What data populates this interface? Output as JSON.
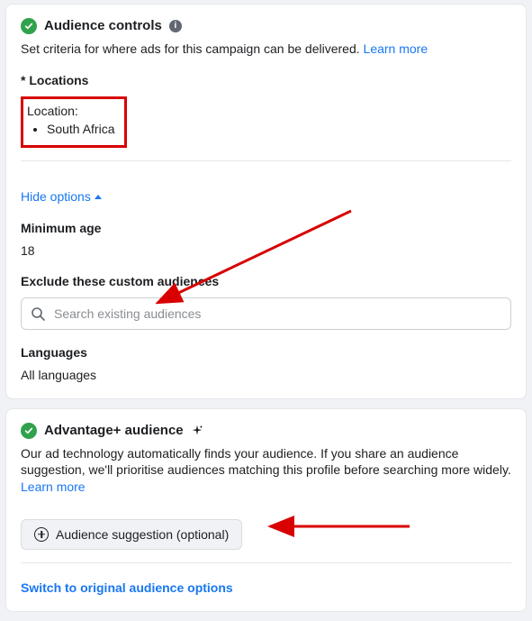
{
  "audience_controls": {
    "title": "Audience controls",
    "desc": "Set criteria for where ads for this campaign can be delivered. ",
    "learn_more": "Learn more",
    "locations_label": "* Locations",
    "location_title": "Location:",
    "location_items": [
      "South Africa"
    ],
    "hide_options": "Hide options",
    "min_age_label": "Minimum age",
    "min_age_value": "18",
    "exclude_label": "Exclude these custom audiences",
    "search_placeholder": "Search existing audiences",
    "languages_label": "Languages",
    "languages_value": "All languages"
  },
  "advantage": {
    "title": "Advantage+ audience",
    "desc": "Our ad technology automatically finds your audience. If you share an audience suggestion, we'll prioritise audiences matching this profile before searching more widely.",
    "learn_more": "Learn more",
    "suggestion_button": "Audience suggestion (optional)",
    "switch_link": "Switch to original audience options"
  }
}
